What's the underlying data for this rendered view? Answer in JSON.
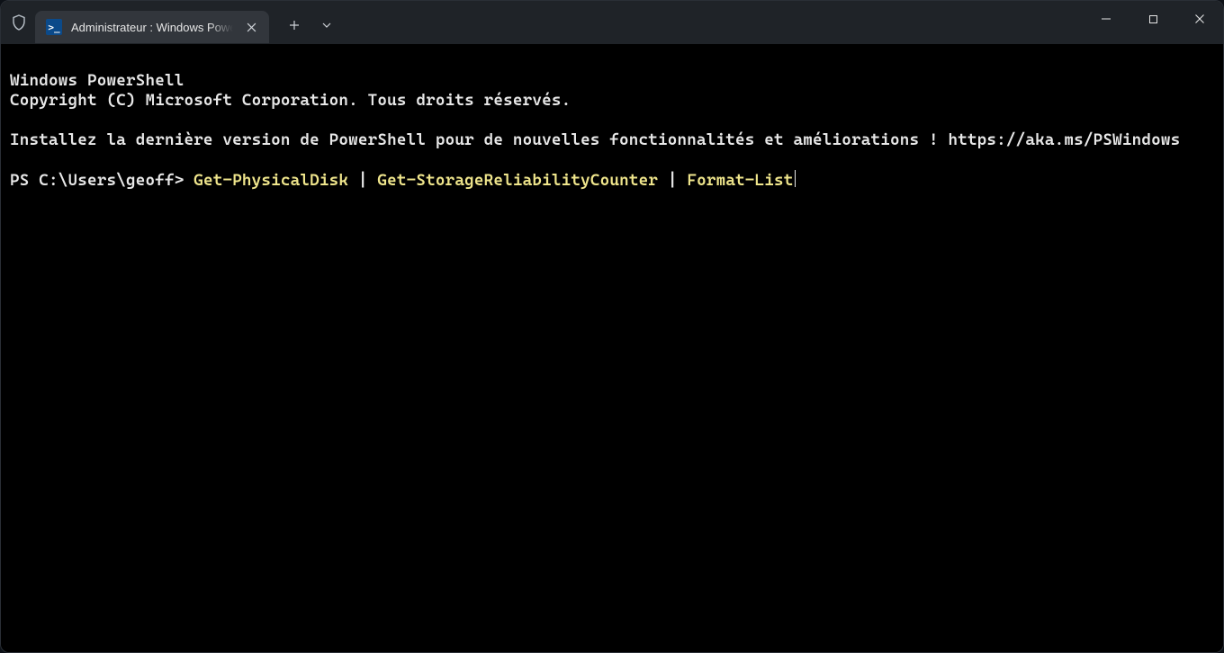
{
  "tab": {
    "title": "Administrateur : Windows PowerShell"
  },
  "terminal": {
    "line1": "Windows PowerShell",
    "line2": "Copyright (C) Microsoft Corporation. Tous droits réservés.",
    "line3": "Installez la dernière version de PowerShell pour de nouvelles fonctionnalités et améliorations ! https://aka.ms/PSWindows",
    "prompt": "PS C:\\Users\\geoff> ",
    "cmd_part1": "Get-PhysicalDisk",
    "pipe": " | ",
    "cmd_part2": "Get-StorageReliabilityCounter",
    "cmd_part3": "Format-List"
  },
  "icons": {
    "ps_glyph": ">_"
  }
}
